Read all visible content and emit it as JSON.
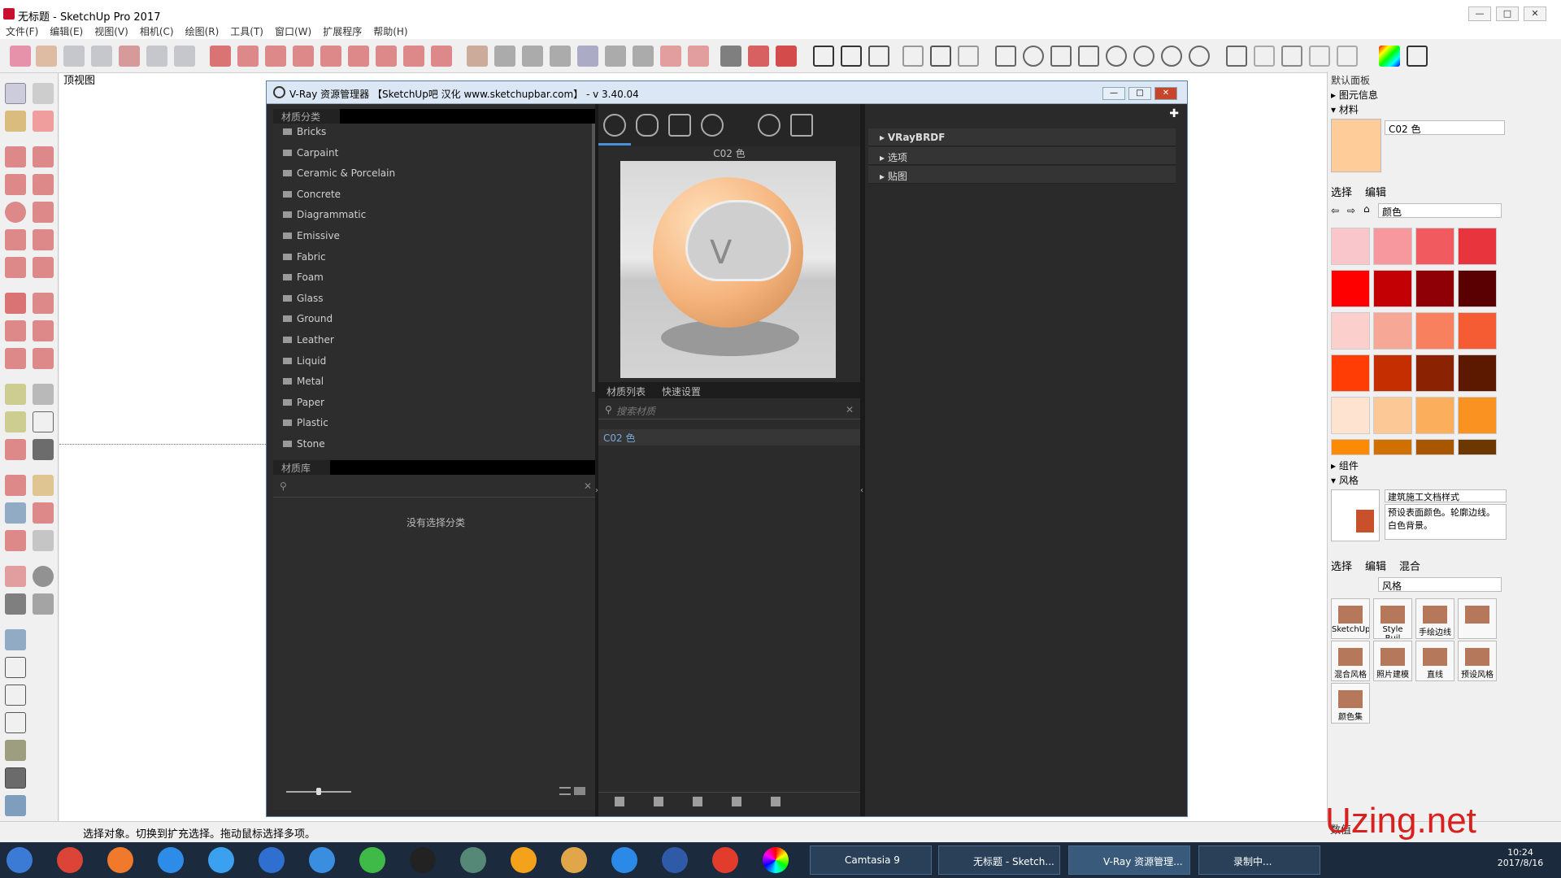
{
  "app": {
    "window_title": "无标题 - SketchUp Pro 2017",
    "view_label": "顶视图",
    "menu": [
      "文件(F)",
      "编辑(E)",
      "视图(V)",
      "相机(C)",
      "绘图(R)",
      "工具(T)",
      "窗口(W)",
      "扩展程序",
      "帮助(H)"
    ]
  },
  "vray": {
    "title": "V-Ray 资源管理器 【SketchUp吧 汉化 www.sketchupbar.com】 - v 3.40.04",
    "category_header": "材质分类",
    "categories": [
      "Bricks",
      "Carpaint",
      "Ceramic & Porcelain",
      "Concrete",
      "Diagrammatic",
      "Emissive",
      "Fabric",
      "Foam",
      "Glass",
      "Ground",
      "Leather",
      "Liquid",
      "Metal",
      "Paper",
      "Plastic",
      "Stone"
    ],
    "library_header": "材质库",
    "library_empty": "没有选择分类",
    "material_name": "C02 色",
    "tab_list": "材质列表",
    "tab_quick": "快速设置",
    "search_placeholder": "搜索材质",
    "material_items": [
      "C02 色"
    ],
    "sections": [
      "VRayBRDF",
      "选项",
      "贴图"
    ]
  },
  "tray": {
    "title": "默认面板",
    "entity_info": "图元信息",
    "materials": "材料",
    "material_field": "C02 色",
    "tab_select": "选择",
    "tab_edit": "编辑",
    "tab_mix": "混合",
    "color_dropdown": "颜色",
    "components": "组件",
    "styles": "风格",
    "style_name": "建筑施工文档样式",
    "style_desc": "预设表面颜色。轮廓边线。白色背景。",
    "style_dropdown": "风格",
    "style_items": [
      "SketchUp",
      "Style Buil",
      "手绘边线",
      "",
      "混合风格",
      "照片建模",
      "直线",
      "预设风格",
      "颜色集"
    ],
    "swatches": [
      "#f9c6cb",
      "#f7989f",
      "#f15a5f",
      "#e8343d",
      "#fe0000",
      "#c30004",
      "#8e0006",
      "#5a0003",
      "#fbd0cc",
      "#f7a796",
      "#f8805f",
      "#f55c34",
      "#ff3d05",
      "#c52e00",
      "#8b2201",
      "#5d1800",
      "#fde3d0",
      "#fcc896",
      "#fbae5b",
      "#fa9221",
      "#fd8a05",
      "#d07000",
      "#a85600",
      "#6d3800"
    ]
  },
  "status": {
    "message": "选择对象。切换到扩充选择。拖动鼠标选择多项。",
    "measure_label": "数值"
  },
  "taskbar": {
    "tasks": [
      "Camtasia 9",
      "无标题 - Sketch...",
      "V-Ray 资源管理...",
      "录制中..."
    ],
    "time": "10:24",
    "date": "2017/8/16"
  },
  "watermark": "Uzing.net",
  "colors": {
    "accent": "#78a9da",
    "brand": "#c8102e",
    "material_swatch": "#fdcc99"
  }
}
